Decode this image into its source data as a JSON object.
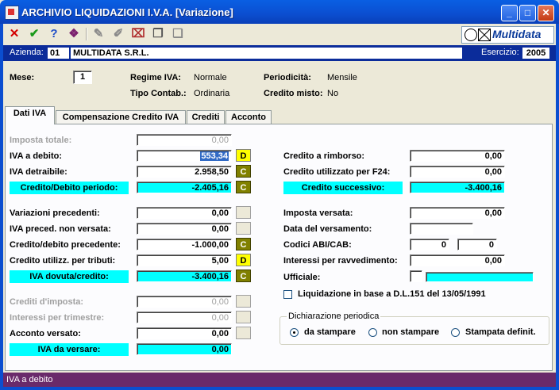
{
  "window": {
    "title": "ARCHIVIO LIQUIDAZIONI I.V.A. [Variazione]",
    "minimize": "_",
    "maximize": "□",
    "close": "✕"
  },
  "toolbar": {
    "icons": [
      "cancel-icon",
      "confirm-icon",
      "help-icon",
      "book-icon",
      "edit-icon",
      "new-icon",
      "delete-icon",
      "copy-icon",
      "paste-icon"
    ],
    "cancel": "✕",
    "confirm": "✔",
    "help": "?",
    "book": "❖",
    "edit": "✎",
    "new": "✐",
    "delete": "⌧",
    "copy": "❐",
    "paste": "❏",
    "brand": "Multidata"
  },
  "company_bar": {
    "azienda_label": "Azienda:",
    "azienda_code": "01",
    "azienda_name": "MULTIDATA S.R.L.",
    "esercizio_label": "Esercizio:",
    "esercizio_value": "2005"
  },
  "header": {
    "mese_label": "Mese:",
    "mese_value": "1",
    "regime_label": "Regime IVA:",
    "regime_value": "Normale",
    "periodicita_label": "Periodicità:",
    "periodicita_value": "Mensile",
    "tipo_label": "Tipo Contab.:",
    "tipo_value": "Ordinaria",
    "credito_misto_label": "Credito misto:",
    "credito_misto_value": "No"
  },
  "tabs": [
    {
      "label": "Dati IVA",
      "active": true
    },
    {
      "label": "Compensazione Credito IVA",
      "active": false
    },
    {
      "label": "Crediti",
      "active": false
    },
    {
      "label": "Acconto",
      "active": false
    }
  ],
  "left": {
    "imposta_totale": {
      "label": "Imposta totale:",
      "value": "0,00"
    },
    "iva_debito": {
      "label": "IVA a debito:",
      "value": "553,34",
      "tag": "D"
    },
    "iva_detraibile": {
      "label": "IVA detraibile:",
      "value": "2.958,50",
      "tag": "C"
    },
    "credito_debito_periodo": {
      "label": "Credito/Debito periodo:",
      "value": "-2.405,16",
      "tag": "C"
    },
    "variazioni_precedenti": {
      "label": "Variazioni precedenti:",
      "value": "0,00"
    },
    "iva_preced_non_versata": {
      "label": "IVA preced. non versata:",
      "value": "0,00"
    },
    "credito_debito_precedente": {
      "label": "Credito/debito precedente:",
      "value": "-1.000,00",
      "tag": "C"
    },
    "credito_utilizz_tributi": {
      "label": "Credito utilizz. per tributi:",
      "value": "5,00",
      "tag": "D"
    },
    "iva_dovuta_credito": {
      "label": "IVA dovuta/credito:",
      "value": "-3.400,16",
      "tag": "C"
    },
    "crediti_imposta": {
      "label": "Crediti d'imposta:",
      "value": "0,00"
    },
    "interessi_trimestre": {
      "label": "Interessi per trimestre:",
      "value": "0,00"
    },
    "acconto_versato": {
      "label": "Acconto versato:",
      "value": "0,00"
    },
    "iva_da_versare": {
      "label": "IVA da versare:",
      "value": "0,00"
    }
  },
  "right": {
    "credito_rimborso": {
      "label": "Credito a rimborso:",
      "value": "0,00"
    },
    "credito_f24": {
      "label": "Credito utilizzato per F24:",
      "value": "0,00"
    },
    "credito_successivo": {
      "label": "Credito successivo:",
      "value": "-3.400,16"
    },
    "imposta_versata": {
      "label": "Imposta versata:",
      "value": "0,00"
    },
    "data_versamento": {
      "label": "Data del versamento:",
      "value": ""
    },
    "codici_abi_cab": {
      "label": "Codici ABI/CAB:",
      "abi": "0",
      "cab": "0"
    },
    "interessi_ravvedimento": {
      "label": "Interessi per ravvedimento:",
      "value": "0,00"
    },
    "ufficiale": {
      "label": "Ufficiale:",
      "value": ""
    },
    "liquidazione_dl151": {
      "label": "Liquidazione in base a D.L.151 del 13/05/1991",
      "checked": false
    },
    "dichiarazione": {
      "legend": "Dichiarazione periodica",
      "options": [
        "da stampare",
        "non stampare",
        "Stampata definit."
      ],
      "selected": "da stampare"
    }
  },
  "status": {
    "text": "IVA a debito"
  },
  "colors": {
    "title_bar": "#0b4ed0",
    "company_bar": "#0b2c9a",
    "highlight": "#00ffff",
    "tag_debit": "#ffff00",
    "tag_credit": "#808000",
    "status_bar": "#6a2a6a"
  }
}
